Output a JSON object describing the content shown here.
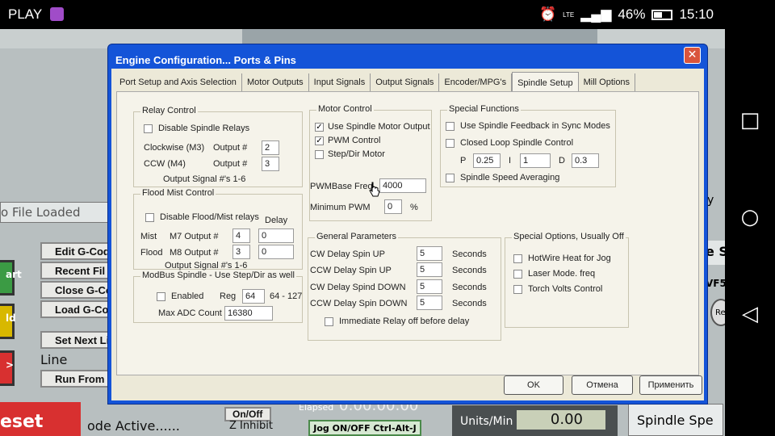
{
  "status": {
    "carrier": "PLAY",
    "network": "LTE",
    "battery": "46%",
    "time": "15:10"
  },
  "bg": {
    "file_loaded": "o File Loaded",
    "edit": "Edit G-Cod",
    "recent": "Recent Fil",
    "close": "Close G-Co",
    "load": "Load G-Coc",
    "next_line": "Set Next Li",
    "line": "Line",
    "run_from": "Run From H",
    "reset": "eset",
    "mode_active": "ode Active......",
    "onoff": "On/Off",
    "z_inhibit": "Z Inhibit",
    "elapsed": "Elapsed",
    "elapsed_val": "0:00:00:00",
    "jog": "Jog ON/OFF Ctrl-Alt-J",
    "units_min": "Units/Min",
    "units_val": "0.00",
    "spindle_speed": "Spindle Spe",
    "side1": "art",
    "side2": "ld",
    "side3": ">",
    "right1": "y",
    "right2": "e S",
    "right3": "VF5",
    "right4": "Re"
  },
  "dialog": {
    "title": "Engine Configuration... Ports & Pins",
    "tabs": [
      "Port Setup and Axis Selection",
      "Motor Outputs",
      "Input Signals",
      "Output Signals",
      "Encoder/MPG's",
      "Spindle Setup",
      "Mill Options"
    ],
    "relay": {
      "title": "Relay Control",
      "disable": "Disable Spindle Relays",
      "cw": "Clockwise (M3)",
      "ccw": "CCW (M4)",
      "output": "Output #",
      "cw_val": "2",
      "ccw_val": "3",
      "signals": "Output Signal #'s 1-6"
    },
    "flood": {
      "title": "Flood Mist Control",
      "disable": "Disable Flood/Mist relays",
      "delay": "Delay",
      "mist": "Mist",
      "m7": "M7 Output #",
      "m7_val": "4",
      "m7_delay": "0",
      "flood": "Flood",
      "m8": "M8 Output #",
      "m8_val": "3",
      "m8_delay": "0",
      "signals": "Output Signal #'s 1-6"
    },
    "modbus": {
      "title": "ModBus Spindle - Use Step/Dir as well",
      "enabled": "Enabled",
      "reg": "Reg",
      "reg_val": "64",
      "range": "64 - 127",
      "max_adc": "Max ADC Count",
      "max_adc_val": "16380"
    },
    "motor": {
      "title": "Motor Control",
      "use_output": "Use Spindle Motor Output",
      "pwm": "PWM Control",
      "stepdir": "Step/Dir Motor",
      "pwm_base": "PWMBase Freq.",
      "pwm_base_val": "4000",
      "min_pwm": "Minimum PWM",
      "min_pwm_val": "0",
      "pct": "%"
    },
    "special": {
      "title": "Special Functions",
      "feedback": "Use Spindle Feedback in Sync Modes",
      "closed_loop": "Closed Loop Spindle Control",
      "p": "P",
      "p_val": "0.25",
      "i": "I",
      "i_val": "1",
      "d": "D",
      "d_val": "0.3",
      "averaging": "Spindle Speed Averaging"
    },
    "general": {
      "title": "General Parameters",
      "cw_up": "CW Delay Spin UP",
      "ccw_up": "CCW Delay Spin UP",
      "cw_down": "CW Delay Spind DOWN",
      "ccw_down": "CCW Delay Spin DOWN",
      "val": "5",
      "seconds": "Seconds",
      "immediate": "Immediate Relay off before delay"
    },
    "options": {
      "title": "Special Options, Usually Off",
      "hotwire": "HotWire Heat for Jog",
      "laser": "Laser Mode. freq",
      "torch": "Torch Volts Control"
    },
    "ok": "OK",
    "cancel": "Отмена",
    "apply": "Применить"
  }
}
